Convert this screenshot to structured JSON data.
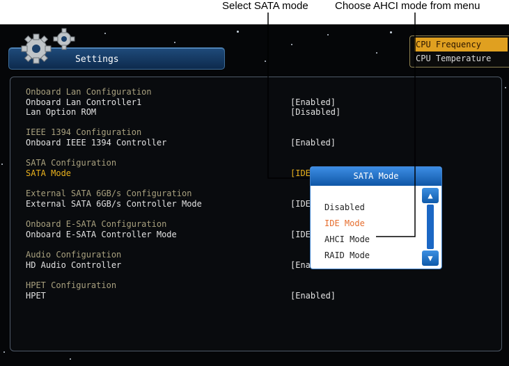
{
  "callouts": {
    "select_sata": "Select SATA mode",
    "choose_ahci": "Choose AHCI mode from menu"
  },
  "header": {
    "settings_tab": "Settings"
  },
  "right_menu": {
    "items": [
      "CPU Frequency",
      "CPU Temperature"
    ],
    "selected": "CPU Frequency"
  },
  "main": {
    "rows": [
      {
        "kind": "header",
        "label": "Onboard Lan Configuration"
      },
      {
        "kind": "item",
        "label": "Onboard Lan Controller1",
        "value": "[Enabled]"
      },
      {
        "kind": "item",
        "label": "Lan Option ROM",
        "value": "[Disabled]"
      },
      {
        "kind": "header",
        "label": "IEEE 1394 Configuration"
      },
      {
        "kind": "item",
        "label": "Onboard IEEE 1394 Controller",
        "value": "[Enabled]"
      },
      {
        "kind": "header",
        "label": "SATA Configuration"
      },
      {
        "kind": "item",
        "label": "SATA Mode",
        "value": "[IDE",
        "selected": true
      },
      {
        "kind": "header",
        "label": "External SATA 6GB/s Configuration"
      },
      {
        "kind": "item",
        "label": "External SATA 6GB/s Controller Mode",
        "value": "[IDE"
      },
      {
        "kind": "header",
        "label": "Onboard E-SATA Configuration"
      },
      {
        "kind": "item",
        "label": "Onboard E-SATA Controller Mode",
        "value": "[IDE"
      },
      {
        "kind": "header",
        "label": "Audio Configuration"
      },
      {
        "kind": "item",
        "label": "HD Audio Controller",
        "value": "[Ena"
      },
      {
        "kind": "header",
        "label": "HPET Configuration"
      },
      {
        "kind": "item",
        "label": "HPET",
        "value": "[Enabled]"
      }
    ]
  },
  "popup": {
    "title": "SATA Mode",
    "options": [
      "Disabled",
      "IDE Mode",
      "AHCI Mode",
      "RAID Mode"
    ],
    "current": "IDE Mode",
    "scroll_up": "▲",
    "scroll_down": "▼"
  },
  "colors": {
    "header_text": "#a8a07e",
    "selected_text": "#e9b11d",
    "popup_blue": "#1f6fc4",
    "highlight_orange": "#e0a020"
  }
}
